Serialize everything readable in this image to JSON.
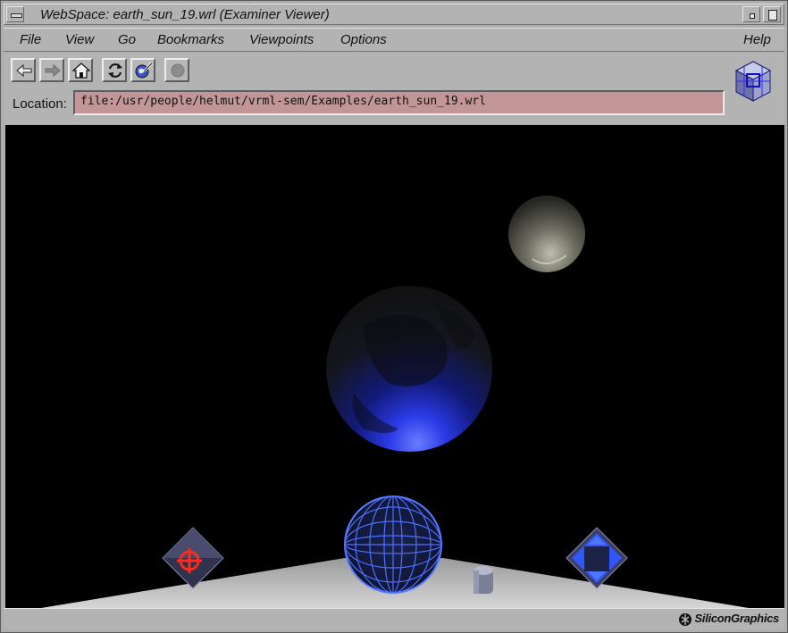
{
  "window": {
    "title": "WebSpace: earth_sun_19.wrl (Examiner Viewer)"
  },
  "menu": [
    "File",
    "View",
    "Go",
    "Bookmarks",
    "Viewpoints",
    "Options",
    "Help"
  ],
  "toolbar": {
    "buttons": [
      "back-arrow-icon",
      "forward-arrow-icon",
      "home-icon",
      "reload-icon",
      "edit-globe-icon",
      "stop-icon"
    ]
  },
  "location": {
    "label": "Location:",
    "value": "file:/usr/people/helmut/vrml-sem/Examples/earth_sun_19.wrl"
  },
  "footer": {
    "brand": "SiliconGraphics"
  },
  "colors": {
    "chrome": "#b3b3b3",
    "location_field": "#c29696",
    "viewport_bg": "#000000",
    "accent_blue": "#2e3cff"
  }
}
